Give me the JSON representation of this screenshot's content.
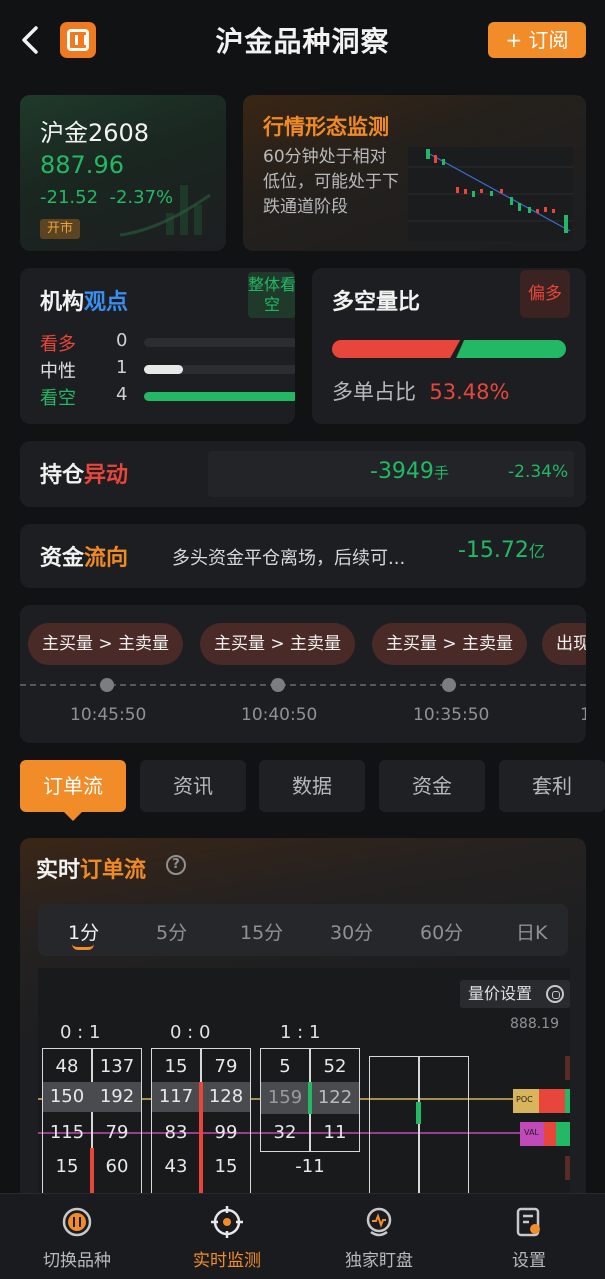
{
  "header": {
    "title": "沪金品种洞察",
    "subscribe_label": "+ 订阅"
  },
  "price_card": {
    "name": "沪金2608",
    "price": "887.96",
    "change_abs": "-21.52",
    "change_pct": "-2.37%",
    "status": "开市"
  },
  "pattern_card": {
    "title": "行情形态监测",
    "description": "60分钟处于相对低位，可能处于下跌通道阶段"
  },
  "institution_card": {
    "title_a": "机构",
    "title_b": "观点",
    "badge": "整体看空",
    "rows": [
      {
        "label": "看多",
        "count": "0",
        "fraction": 0.0
      },
      {
        "label": "中性",
        "count": "1",
        "fraction": 0.25
      },
      {
        "label": "看空",
        "count": "4",
        "fraction": 1.0
      }
    ]
  },
  "ratio_card": {
    "title_a": "多空",
    "title_b": "量比",
    "badge": "偏多",
    "label": "多单占比",
    "value": "53.48%",
    "long_fraction": 0.5348
  },
  "position_card": {
    "title_a": "持仓",
    "title_b": "异动",
    "value": "-3949",
    "unit": "手",
    "pct": "-2.34%"
  },
  "fund_card": {
    "title_a": "资金",
    "title_b": "流向",
    "text": "多头资金平仓离场，后续可...",
    "value": "-15.72",
    "unit": "亿"
  },
  "timeline": {
    "events": [
      {
        "label": "主买量 > 主卖量",
        "time": "10:45:50"
      },
      {
        "label": "主买量 > 主卖量",
        "time": "10:40:50"
      },
      {
        "label": "主买量 > 主卖量",
        "time": "10:35:50"
      },
      {
        "label": "出现",
        "time": "1"
      }
    ]
  },
  "tabs": [
    "订单流",
    "资讯",
    "数据",
    "资金",
    "套利"
  ],
  "order_flow": {
    "title_a": "实时",
    "title_b": "订单流",
    "help": "?",
    "intervals": [
      "1分",
      "5分",
      "15分",
      "30分",
      "60分",
      "日K"
    ],
    "volume_setting": "量价设置",
    "top_price": "888.19",
    "bars": [
      {
        "ratio": "0 : 1",
        "rows": [
          [
            "48",
            "137"
          ],
          [
            "150",
            "192"
          ],
          [
            "115",
            "79"
          ],
          [
            "15",
            "60"
          ]
        ]
      },
      {
        "ratio": "0 : 0",
        "rows": [
          [
            "15",
            "79"
          ],
          [
            "117",
            "128"
          ],
          [
            "83",
            "99"
          ],
          [
            "43",
            "15"
          ]
        ]
      },
      {
        "ratio": "1 : 1",
        "rows": [
          [
            "5",
            "52"
          ],
          [
            "159",
            "122"
          ],
          [
            "32",
            "11"
          ]
        ],
        "delta": "-11"
      }
    ],
    "poc_label": "POC",
    "val_label": "VAL"
  },
  "bottom_nav": [
    {
      "label": "切换品种",
      "icon": "switch-icon"
    },
    {
      "label": "实时监测",
      "icon": "target-icon"
    },
    {
      "label": "独家盯盘",
      "icon": "watch-icon"
    },
    {
      "label": "设置",
      "icon": "settings-icon"
    }
  ],
  "colors": {
    "accent": "#f28c28",
    "up": "#e8463a",
    "down": "#23b864",
    "blue": "#3a8ef0"
  }
}
